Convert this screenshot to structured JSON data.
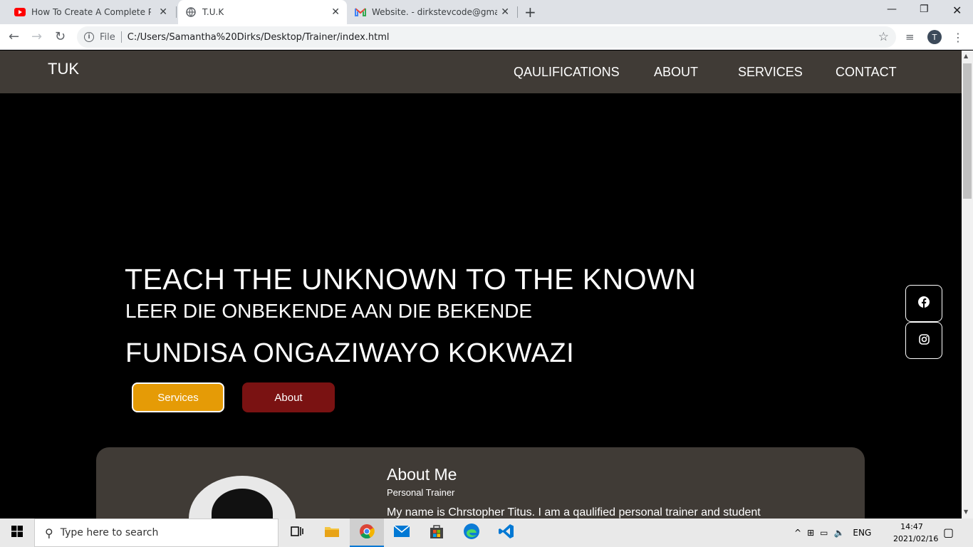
{
  "browser": {
    "tabs": [
      {
        "title": "How To Create A Complete Personal",
        "icon": "youtube-icon"
      },
      {
        "title": "T.U.K",
        "icon": "globe-icon"
      },
      {
        "title": "Website. - dirkstevcode@gmail.c",
        "icon": "gmail-icon"
      }
    ],
    "scheme": "File",
    "url": "C:/Users/Samantha%20Dirks/Desktop/Trainer/index.html",
    "profile_initial": "T"
  },
  "site": {
    "logo": "TUK",
    "nav": [
      "QAULIFICATIONS",
      "ABOUT",
      "SERVICES",
      "CONTACT"
    ],
    "hero": {
      "line1": "TEACH THE UNKNOWN TO THE KNOWN",
      "line2": "LEER DIE ONBEKENDE AAN DIE BEKENDE",
      "line3": "FUNDISA ONGAZIWAYO KOKWAZI"
    },
    "buttons": {
      "services": "Services",
      "about": "About"
    },
    "about": {
      "title": "About Me",
      "subtitle": "Personal Trainer",
      "text": "My name is Chrstopher Titus. I am a qaulified personal trainer and student"
    },
    "colors": {
      "nav_bg": "#403b36",
      "services_btn": "#e59b06",
      "about_btn": "#7a1212"
    }
  },
  "taskbar": {
    "search_placeholder": "Type here to search",
    "language": "ENG",
    "time": "14:47",
    "date": "2021/02/16"
  }
}
